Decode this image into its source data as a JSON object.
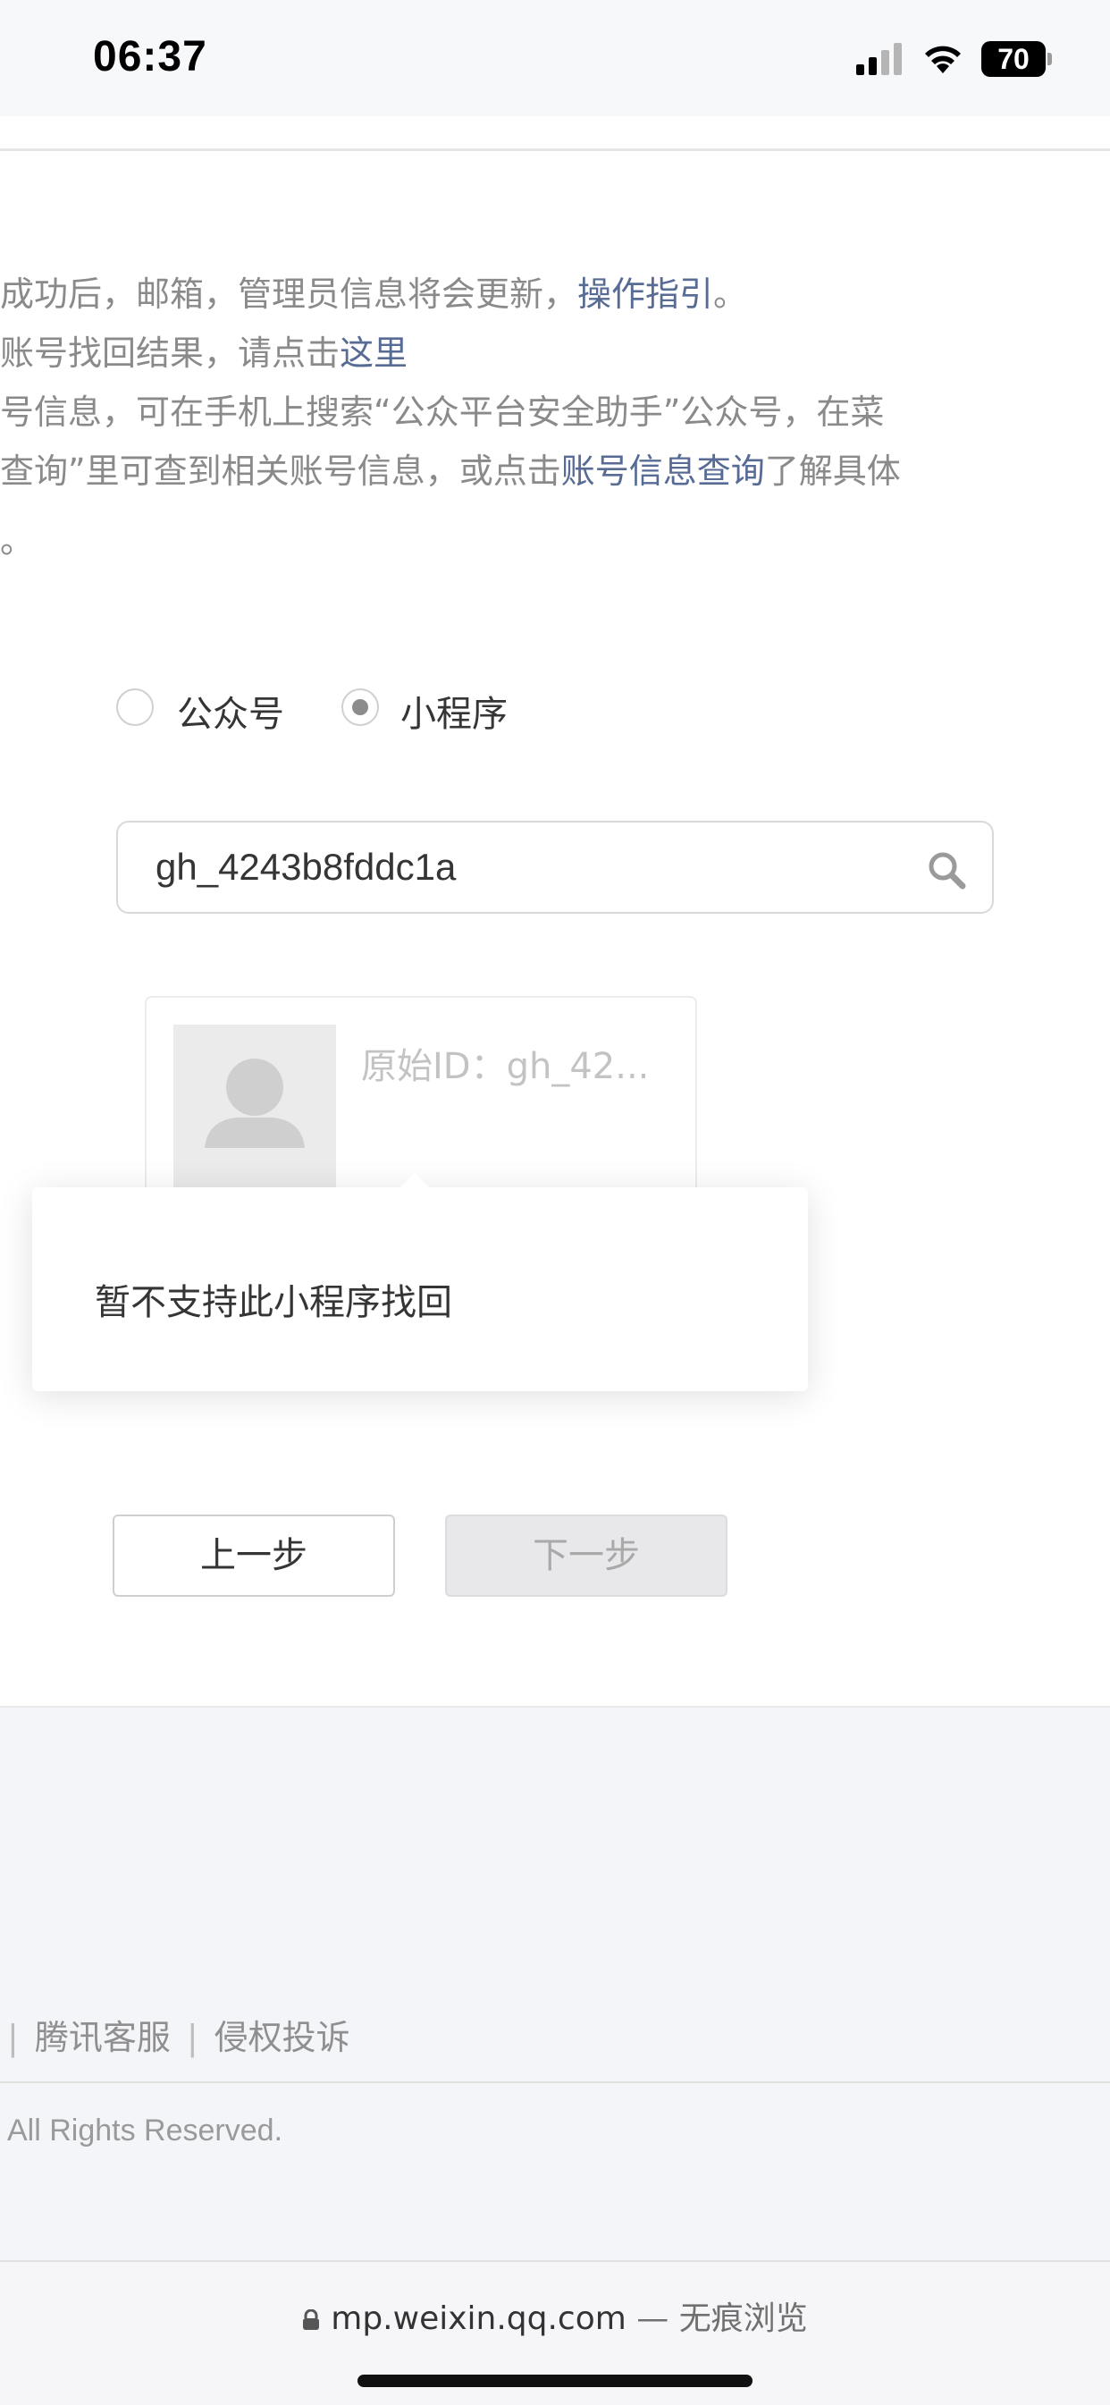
{
  "status_bar": {
    "time": "06:37",
    "battery": "70"
  },
  "notes": {
    "line1_text": "成功后，邮箱，管理员信息将会更新，",
    "line1_link": "操作指引",
    "line1_end": "。",
    "line2_text": "账号找回结果，请点击",
    "line2_link": "这里",
    "line3_text": "号信息，可在手机上搜索“公众平台安全助手”公众号，在菜",
    "line4_text": "查询”里可查到相关账号信息，或点击",
    "line4_link": "账号信息查询",
    "line4_end": "了解具体",
    "line5_text": "。"
  },
  "account_type": {
    "options": [
      "公众号",
      "小程序"
    ],
    "selected": "小程序"
  },
  "search": {
    "value": "gh_4243b8fddc1a"
  },
  "result_card": {
    "original_id": "原始ID：gh_42..."
  },
  "popup": {
    "message": "暂不支持此小程序找回"
  },
  "buttons": {
    "prev": "上一步",
    "next": "下一步"
  },
  "footer": {
    "links": [
      "腾讯客服",
      "侵权投诉"
    ],
    "copyright": "All Rights Reserved."
  },
  "browser": {
    "url": "mp.weixin.qq.com",
    "mode": "— 无痕浏览"
  },
  "colors": {
    "link": "#576b95",
    "footer_bg": "#f4f5f8",
    "disabled_button": "#e8e8ea"
  }
}
